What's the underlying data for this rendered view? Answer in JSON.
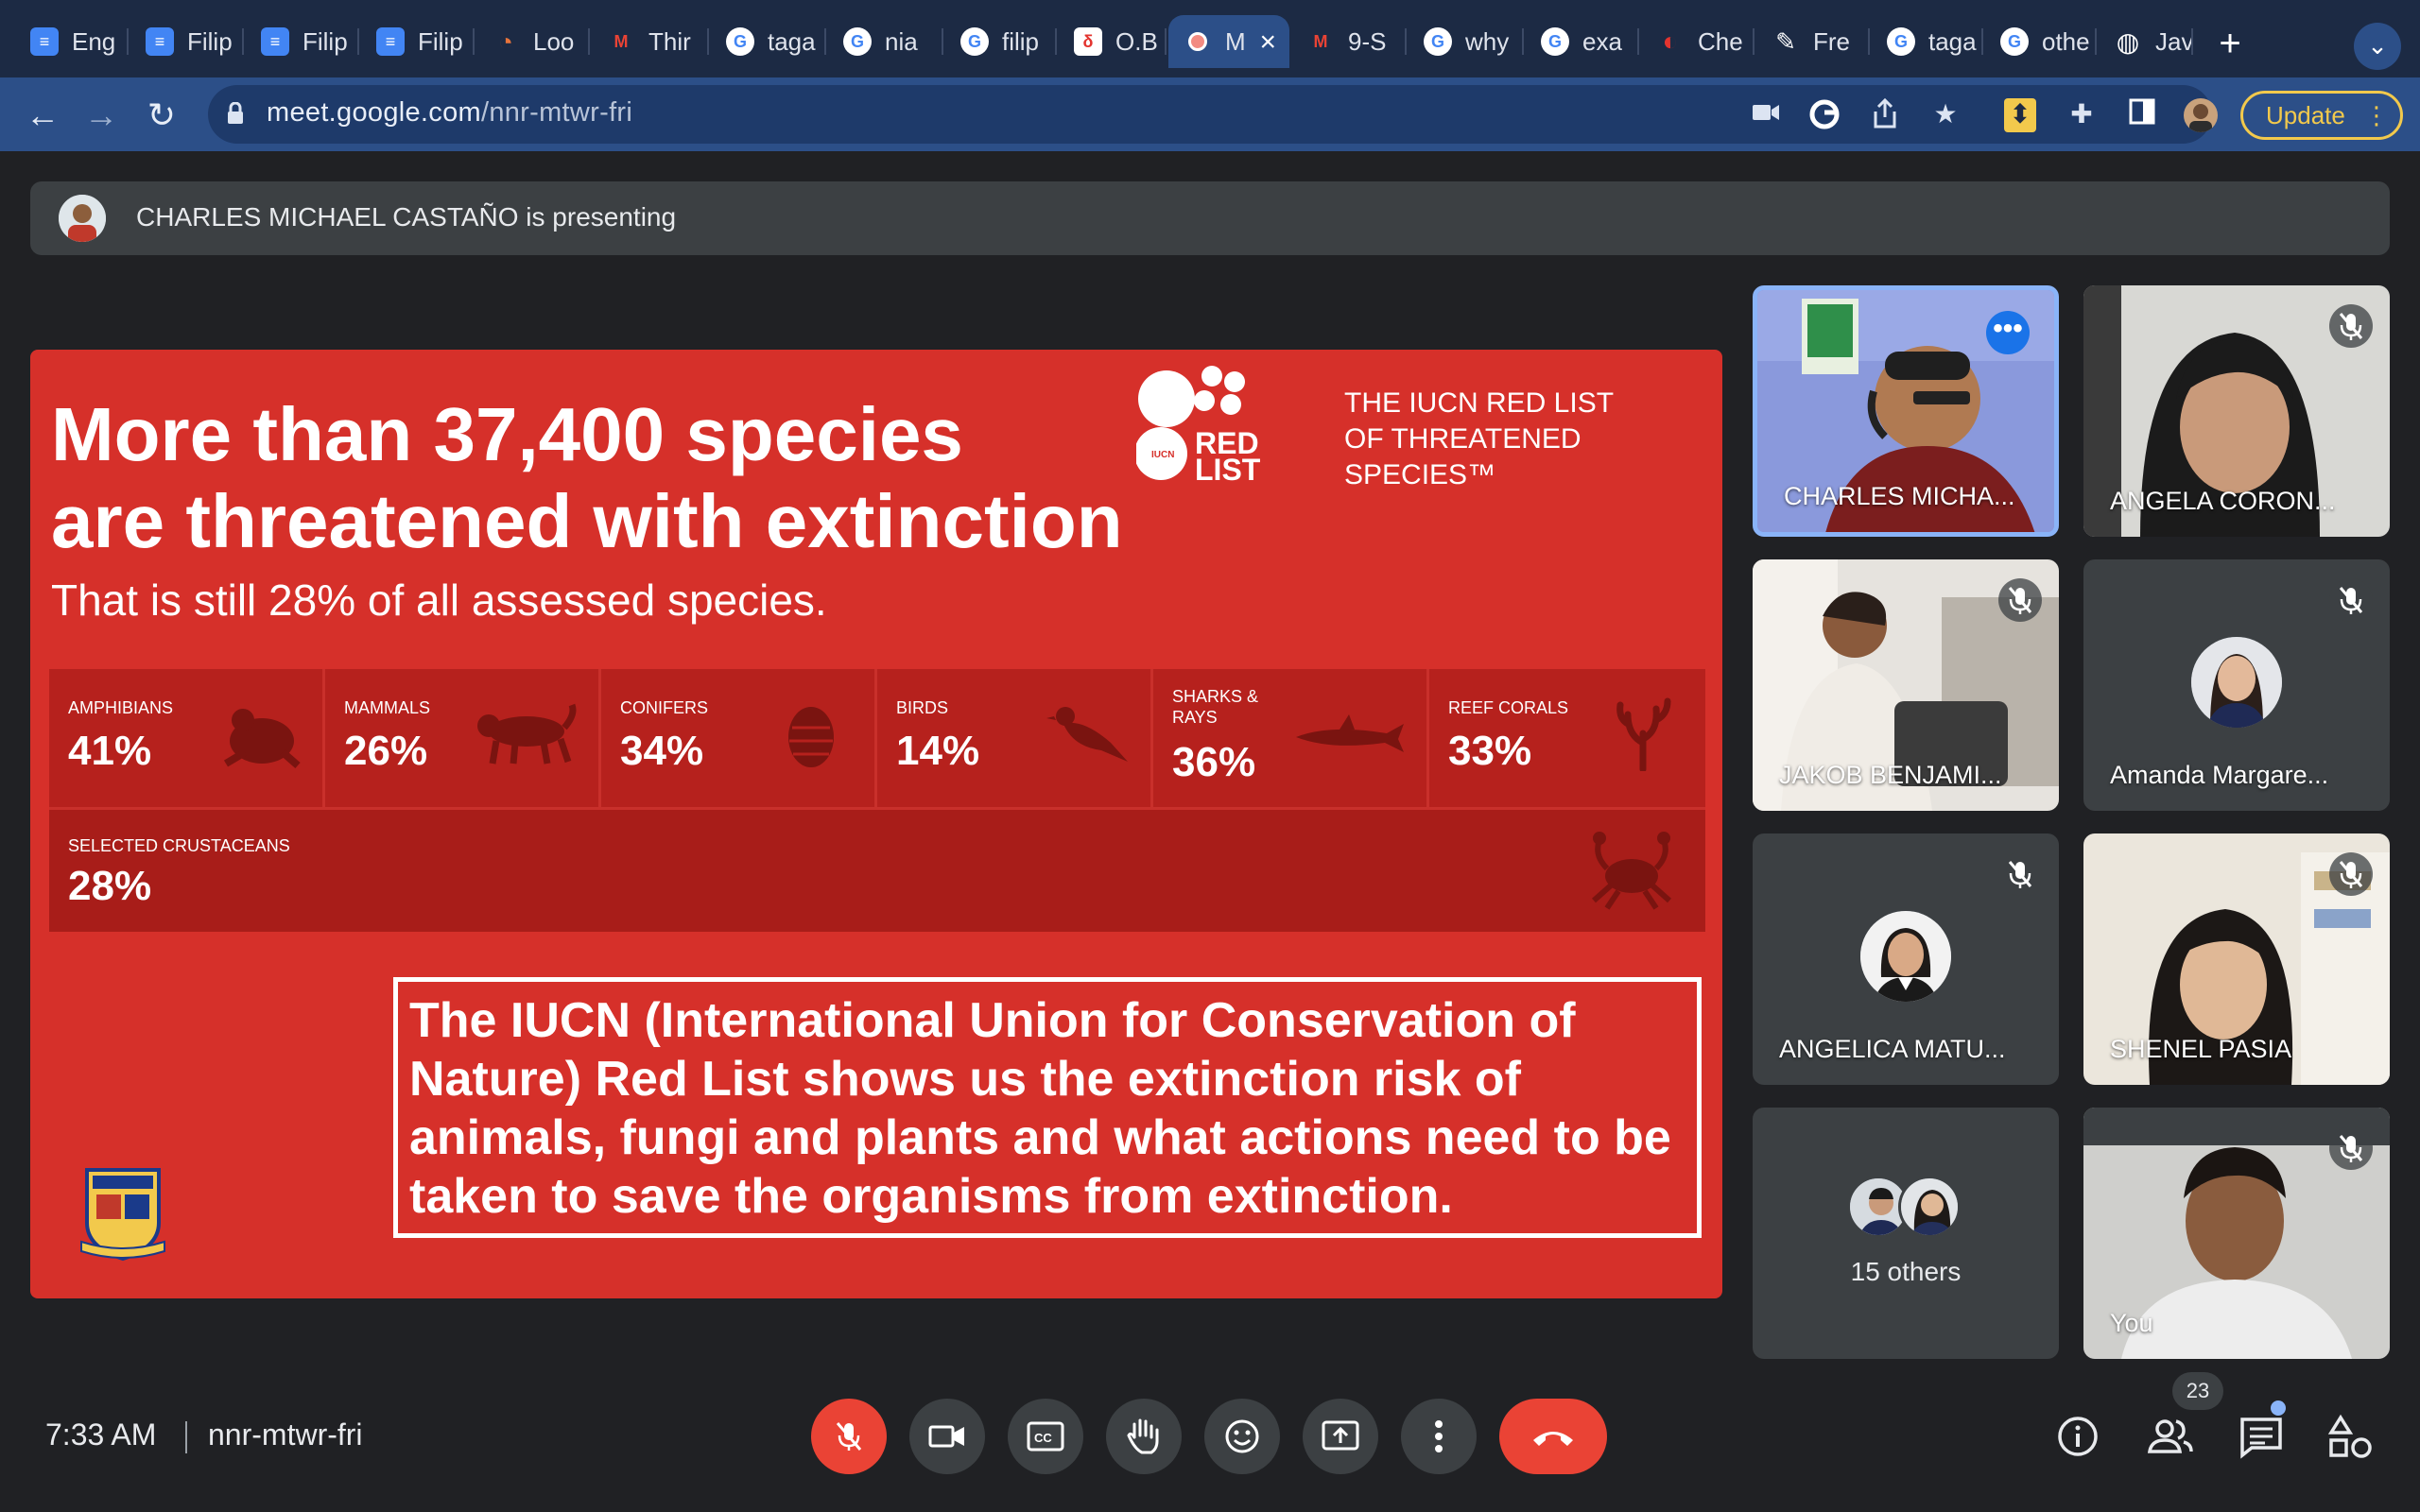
{
  "browser": {
    "tabs": [
      {
        "title": "Eng",
        "favicon": "docs-icon",
        "color": "#4285f4"
      },
      {
        "title": "Filip",
        "favicon": "forms-icon",
        "color": "#4285f4"
      },
      {
        "title": "Filip",
        "favicon": "forms-icon",
        "color": "#4285f4"
      },
      {
        "title": "Filip",
        "favicon": "forms-icon",
        "color": "#4285f4"
      },
      {
        "title": "Loo",
        "favicon": "quillbot-icon",
        "color": "#e8743b"
      },
      {
        "title": "Thir",
        "favicon": "gmail-icon",
        "color": "#ea4335"
      },
      {
        "title": "taga",
        "favicon": "google-icon",
        "color": "#ffffff"
      },
      {
        "title": "nia",
        "favicon": "google-icon",
        "color": "#ffffff"
      },
      {
        "title": "filip",
        "favicon": "google-icon",
        "color": "#ffffff"
      },
      {
        "title": "O.B",
        "favicon": "doc-red-icon",
        "color": "#ffffff"
      },
      {
        "title": "M",
        "favicon": "recording-icon",
        "color": "#2c4f88"
      },
      {
        "title": "9-S",
        "favicon": "gmail-icon",
        "color": "#ea4335"
      },
      {
        "title": "why",
        "favicon": "google-icon",
        "color": "#ffffff"
      },
      {
        "title": "exa",
        "favicon": "google-icon",
        "color": "#ffffff"
      },
      {
        "title": "Che",
        "favicon": "chegg-icon",
        "color": "#e3342f"
      },
      {
        "title": "Fre",
        "favicon": "pen-icon",
        "color": "#ffffff"
      },
      {
        "title": "taga",
        "favicon": "google-icon",
        "color": "#ffffff"
      },
      {
        "title": "othe",
        "favicon": "google-icon",
        "color": "#ffffff"
      },
      {
        "title": "Jav",
        "favicon": "globe-icon",
        "color": "#ffffff"
      }
    ],
    "url_host": "meet.google.com",
    "url_path": "/nnr-mtwr-fri",
    "update_label": "Update"
  },
  "meet": {
    "presenting_text": "CHARLES MICHAEL CASTAÑO is presenting",
    "time": "7:33 AM",
    "meeting_code": "nnr-mtwr-fri",
    "participant_count": "23"
  },
  "slide": {
    "title_line1": "More than 37,400 species",
    "title_line2": "are threatened with extinction",
    "subtitle": "That is still 28% of all assessed species.",
    "redlist_logo_text": "RED LIST",
    "redlist_heading_line1": "THE IUCN RED LIST",
    "redlist_heading_line2": "OF THREATENED SPECIES™",
    "stats": [
      {
        "label": "AMPHIBIANS",
        "value": "41%"
      },
      {
        "label": "MAMMALS",
        "value": "26%"
      },
      {
        "label": "CONIFERS",
        "value": "34%"
      },
      {
        "label": "BIRDS",
        "value": "14%"
      },
      {
        "label": "SHARKS & RAYS",
        "value": "36%"
      },
      {
        "label": "REEF CORALS",
        "value": "33%"
      }
    ],
    "crustaceans": {
      "label": "SELECTED CRUSTACEANS",
      "value": "28%"
    },
    "info_text": "The IUCN (International Union for Conservation of Nature) Red List shows us the extinction risk of animals, fungi and plants and what actions need to be taken to save the organisms from extinction.",
    "colors": {
      "slide_bg": "#d6302a",
      "stats_bg": "#b6211d"
    }
  },
  "participants": [
    {
      "name": "CHARLES MICHA...",
      "muted": false,
      "kind": "video"
    },
    {
      "name": "ANGELA CORON...",
      "muted": true,
      "kind": "video"
    },
    {
      "name": "JAKOB BENJAMI...",
      "muted": true,
      "kind": "video"
    },
    {
      "name": "Amanda Margare...",
      "muted": true,
      "kind": "avatar"
    },
    {
      "name": "ANGELICA MATU...",
      "muted": true,
      "kind": "avatar"
    },
    {
      "name": "SHENEL PASIA",
      "muted": true,
      "kind": "video"
    },
    {
      "name": "15 others",
      "muted": false,
      "kind": "group"
    },
    {
      "name": "You",
      "muted": true,
      "kind": "video"
    }
  ],
  "controls": {
    "buttons": [
      "mic-off",
      "camera",
      "captions",
      "raise-hand",
      "emoji",
      "present",
      "more-options",
      "leave-call"
    ],
    "right_icons": [
      "meeting-details",
      "people",
      "chat",
      "activities"
    ]
  }
}
